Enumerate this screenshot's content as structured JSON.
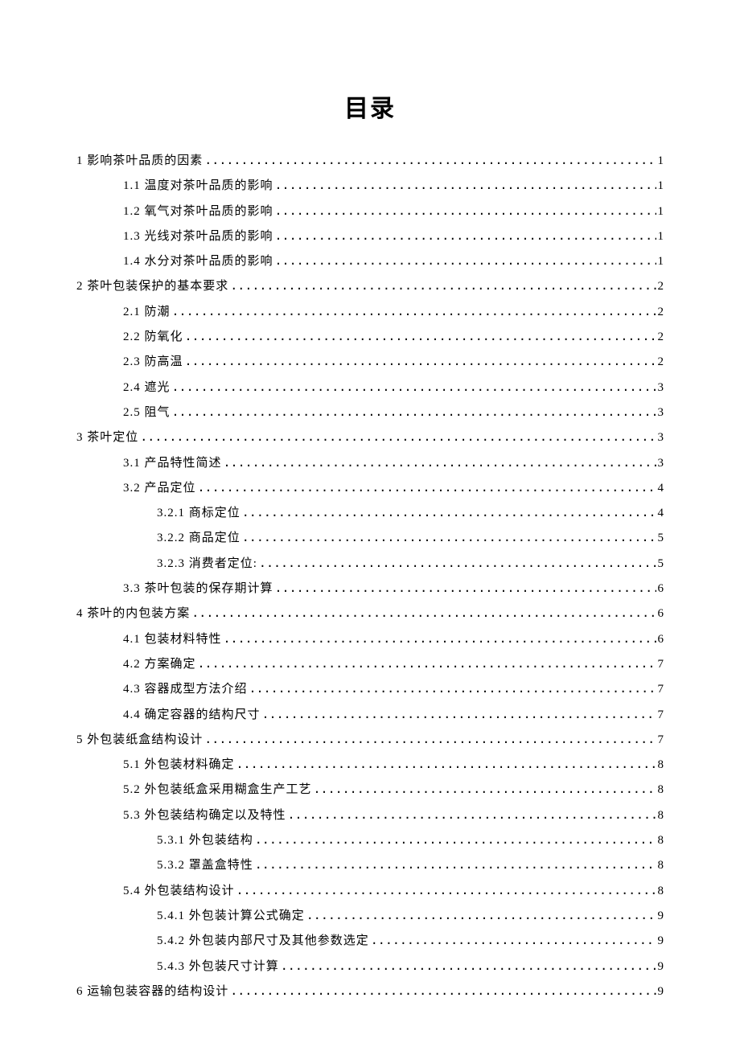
{
  "title": "目录",
  "toc": [
    {
      "level": 1,
      "label": "1 影响茶叶品质的因素",
      "page": "1"
    },
    {
      "level": 2,
      "label": "1.1 温度对茶叶品质的影响 ",
      "page": "1"
    },
    {
      "level": 2,
      "label": "1.2 氧气对茶叶品质的影响 ",
      "page": "1"
    },
    {
      "level": 2,
      "label": "1.3 光线对茶叶品质的影响 ",
      "page": "1"
    },
    {
      "level": 2,
      "label": "1.4 水分对茶叶品质的影响 ",
      "page": "1"
    },
    {
      "level": 1,
      "label": "2 茶叶包装保护的基本要求",
      "page": "2"
    },
    {
      "level": 2,
      "label": "2.1 防潮",
      "page": "2"
    },
    {
      "level": 2,
      "label": "2.2 防氧化",
      "page": "2"
    },
    {
      "level": 2,
      "label": "2.3 防高温",
      "page": "2"
    },
    {
      "level": 2,
      "label": "2.4 遮光",
      "page": "3"
    },
    {
      "level": 2,
      "label": "2.5 阻气",
      "page": "3"
    },
    {
      "level": 1,
      "label": "3 茶叶定位",
      "page": "3"
    },
    {
      "level": 2,
      "label": "3.1 产品特性简述",
      "page": "3"
    },
    {
      "level": 2,
      "label": "3.2 产品定位",
      "page": "4"
    },
    {
      "level": 3,
      "label": "3.2.1 商标定位",
      "page": "4"
    },
    {
      "level": 3,
      "label": "3.2.2 商品定位",
      "page": "5"
    },
    {
      "level": 3,
      "label": "3.2.3 消费者定位:",
      "page": "5"
    },
    {
      "level": 2,
      "label": "3.3 茶叶包装的保存期计算",
      "page": "6"
    },
    {
      "level": 1,
      "label": "4 茶叶的内包装方案",
      "page": "6"
    },
    {
      "level": 2,
      "label": "4.1 包装材料特性",
      "page": "6"
    },
    {
      "level": 2,
      "label": "4.2 方案确定",
      "page": "7"
    },
    {
      "level": 2,
      "label": "4.3 容器成型方法介绍",
      "page": "7"
    },
    {
      "level": 2,
      "label": "4.4 确定容器的结构尺寸",
      "page": "7"
    },
    {
      "level": 1,
      "label": "5 外包装纸盒结构设计",
      "page": "7"
    },
    {
      "level": 2,
      "label": "5.1 外包装材料确定",
      "page": "8"
    },
    {
      "level": 2,
      "label": "5.2 外包装纸盒采用糊盒生产工艺",
      "page": "8"
    },
    {
      "level": 2,
      "label": "5.3 外包装结构确定以及特性",
      "page": "8"
    },
    {
      "level": 3,
      "label": "5.3.1 外包装结构",
      "page": "8"
    },
    {
      "level": 3,
      "label": "5.3.2 罩盖盒特性",
      "page": "8"
    },
    {
      "level": 2,
      "label": "5.4 外包装结构设计 ",
      "page": "8"
    },
    {
      "level": 3,
      "label": "5.4.1 外包装计算公式确定",
      "page": "9"
    },
    {
      "level": 3,
      "label": "5.4.2 外包装内部尺寸及其他参数选定",
      "page": "9"
    },
    {
      "level": 3,
      "label": "5.4.3 外包装尺寸计算 ",
      "page": "9"
    },
    {
      "level": 1,
      "label": "6 运输包装容器的结构设计",
      "page": "9"
    }
  ]
}
